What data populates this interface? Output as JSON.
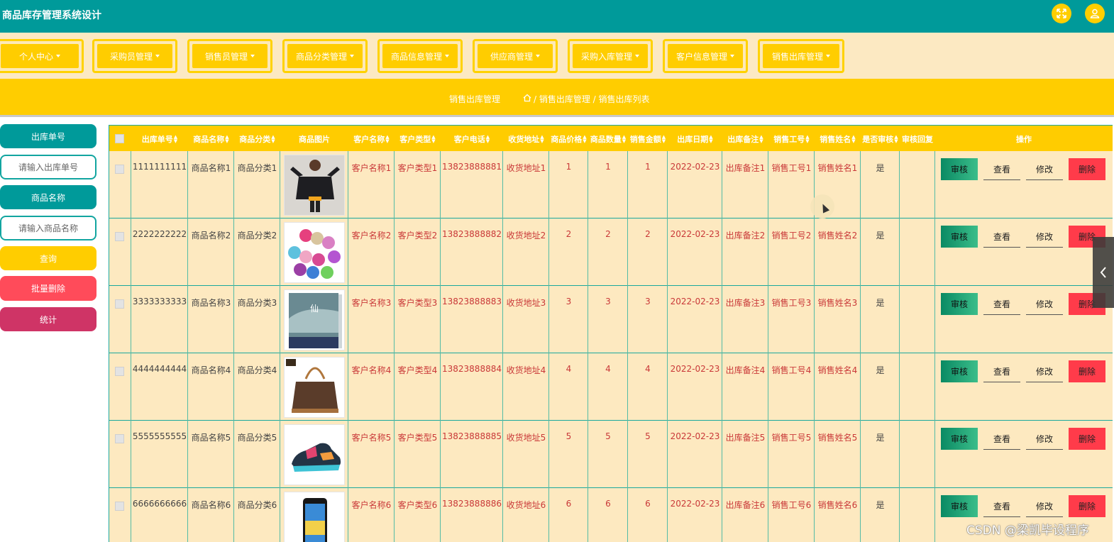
{
  "app": {
    "title": "商品库存管理系统设计",
    "header_icons": [
      "fullscreen-icon",
      "user-icon"
    ]
  },
  "nav": {
    "items": [
      "个人中心",
      "采购员管理",
      "销售员管理",
      "商品分类管理",
      "商品信息管理",
      "供应商管理",
      "采购入库管理",
      "客户信息管理",
      "销售出库管理"
    ]
  },
  "breadcrumb": {
    "section": "销售出库管理",
    "path": "/ 销售出库管理 / 销售出库列表"
  },
  "search": {
    "order_label": "出库单号",
    "order_placeholder": "请输入出库单号",
    "name_label": "商品名称",
    "name_placeholder": "请输入商品名称",
    "query_button": "查询",
    "batch_delete_button": "批量删除",
    "stats_button": "统计"
  },
  "table": {
    "headers": [
      "出库单号",
      "商品名称",
      "商品分类",
      "商品图片",
      "客户名称",
      "客户类型",
      "客户电话",
      "收货地址",
      "商品价格",
      "商品数量",
      "销售金额",
      "出库日期",
      "出库备注",
      "销售工号",
      "销售姓名",
      "是否审核",
      "审核回复",
      "操作"
    ],
    "actions": {
      "audit": "审核",
      "view": "查看",
      "edit": "修改",
      "delete": "删除"
    },
    "rows": [
      {
        "order": "1111111111",
        "name": "商品名称1",
        "category": "商品分类1",
        "image": "hoodie-photo",
        "customer": "客户名称1",
        "ctype": "客户类型1",
        "phone": "13823888881",
        "address": "收货地址1",
        "price": "1",
        "qty": "1",
        "amount": "1",
        "date": "2022-02-23",
        "note": "出库备注1",
        "staff_no": "销售工号1",
        "staff_name": "销售姓名1",
        "audited": "是",
        "reply": ""
      },
      {
        "order": "2222222222",
        "name": "商品名称2",
        "category": "商品分类2",
        "image": "yoga-mats-photo",
        "customer": "客户名称2",
        "ctype": "客户类型2",
        "phone": "13823888882",
        "address": "收货地址2",
        "price": "2",
        "qty": "2",
        "amount": "2",
        "date": "2022-02-23",
        "note": "出库备注2",
        "staff_no": "销售工号2",
        "staff_name": "销售姓名2",
        "audited": "是",
        "reply": ""
      },
      {
        "order": "3333333333",
        "name": "商品名称3",
        "category": "商品分类3",
        "image": "book-photo",
        "customer": "客户名称3",
        "ctype": "客户类型3",
        "phone": "13823888883",
        "address": "收货地址3",
        "price": "3",
        "qty": "3",
        "amount": "3",
        "date": "2022-02-23",
        "note": "出库备注3",
        "staff_no": "销售工号3",
        "staff_name": "销售姓名3",
        "audited": "是",
        "reply": ""
      },
      {
        "order": "4444444444",
        "name": "商品名称4",
        "category": "商品分类4",
        "image": "handbag-photo",
        "customer": "客户名称4",
        "ctype": "客户类型4",
        "phone": "13823888884",
        "address": "收货地址4",
        "price": "4",
        "qty": "4",
        "amount": "4",
        "date": "2022-02-23",
        "note": "出库备注4",
        "staff_no": "销售工号4",
        "staff_name": "销售姓名4",
        "audited": "是",
        "reply": ""
      },
      {
        "order": "5555555555",
        "name": "商品名称5",
        "category": "商品分类5",
        "image": "sneaker-photo",
        "customer": "客户名称5",
        "ctype": "客户类型5",
        "phone": "13823888885",
        "address": "收货地址5",
        "price": "5",
        "qty": "5",
        "amount": "5",
        "date": "2022-02-23",
        "note": "出库备注5",
        "staff_no": "销售工号5",
        "staff_name": "销售姓名5",
        "audited": "是",
        "reply": ""
      },
      {
        "order": "6666666666",
        "name": "商品名称6",
        "category": "商品分类6",
        "image": "phone-photo",
        "customer": "客户名称6",
        "ctype": "客户类型6",
        "phone": "13823888886",
        "address": "收货地址6",
        "price": "6",
        "qty": "6",
        "amount": "6",
        "date": "2022-02-23",
        "note": "出库备注6",
        "staff_no": "销售工号6",
        "staff_name": "销售姓名6",
        "audited": "是",
        "reply": ""
      }
    ]
  },
  "watermark": "CSDN @梁凯毕设程序",
  "colors": {
    "teal": "#009a9a",
    "yellow": "#ffcd00",
    "row_bg": "#fde9c0",
    "red_text": "#c93838"
  }
}
